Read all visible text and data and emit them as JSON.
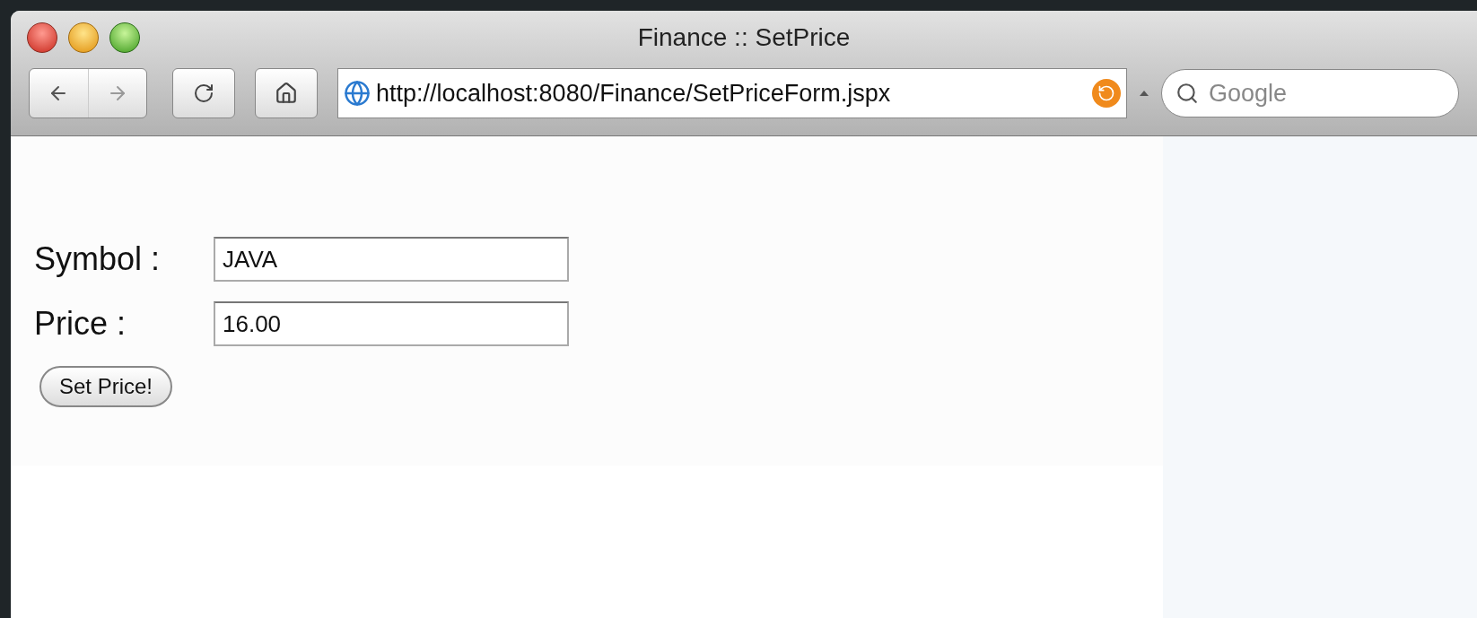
{
  "window": {
    "title": "Finance :: SetPrice"
  },
  "toolbar": {
    "url": "http://localhost:8080/Finance/SetPriceForm.jspx",
    "search": {
      "placeholder": "Google"
    }
  },
  "form": {
    "fields": [
      {
        "label": "Symbol :",
        "value": "JAVA"
      },
      {
        "label": "Price :",
        "value": "16.00"
      }
    ],
    "button": "Set Price!"
  }
}
